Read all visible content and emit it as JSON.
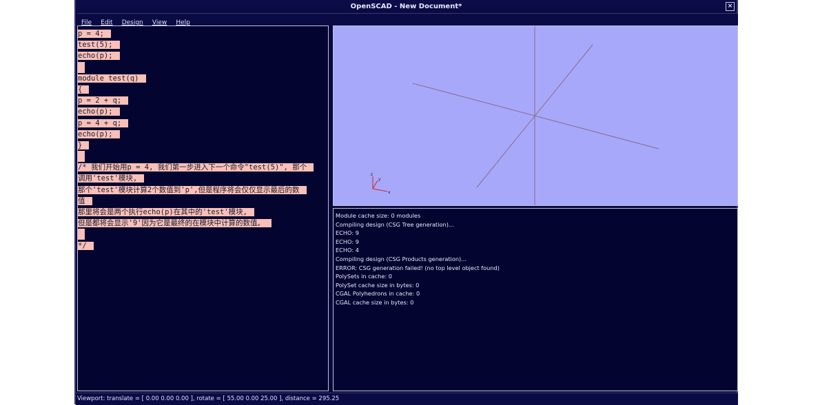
{
  "window": {
    "title": "OpenSCAD - New Document*",
    "close_glyph": "⊠"
  },
  "menu": {
    "items": [
      {
        "label": "File"
      },
      {
        "label": "Edit"
      },
      {
        "label": "Design"
      },
      {
        "label": "View"
      },
      {
        "label": "Help"
      }
    ]
  },
  "editor": {
    "lines": [
      "p = 4;",
      "test(5);",
      "echo(p);",
      "",
      "module test(q)",
      "{",
      "p = 2 + q;",
      "echo(p);",
      "p = 4 + q;",
      "echo(p);",
      "}",
      "",
      "/* 我们开始用p = 4, 我们第一步进入下一个命令\"test(5)\", 那个",
      "调用'test'模块,",
      "那个'test'模块计算2个数值到'p',但是程序将会仅仅显示最后的数",
      "值",
      "那里将会是两个执行echo(p)在其中的'test'模块,",
      "但是都将会显示'9'因为它是最终的在模块中计算的数值。",
      "",
      "*/"
    ]
  },
  "viewport": {
    "background": "#a8a8fa",
    "axis_color": "#8a6a8a",
    "gizmo_labels": [
      "z",
      "y",
      "x"
    ]
  },
  "console": {
    "lines": [
      "Module cache size: 0 modules",
      "Compiling design (CSG Tree generation)...",
      "ECHO: 9",
      "ECHO: 9",
      "ECHO: 4",
      "Compiling design (CSG Products generation)...",
      "ERROR: CSG generation failed! (no top level object found)",
      "PolySets in cache: 0",
      "PolySet cache size in bytes: 0",
      "CGAL Polyhedrons in cache: 0",
      "CGAL cache size in bytes: 0"
    ]
  },
  "status": {
    "text": "Viewport: translate = [ 0.00 0.00 0.00 ], rotate = [ 55.00 0.00 25.00 ], distance = 295.25"
  },
  "colors": {
    "editor_bg": "#040430",
    "highlight": "#f8c0b8",
    "console_bg": "#040430"
  }
}
